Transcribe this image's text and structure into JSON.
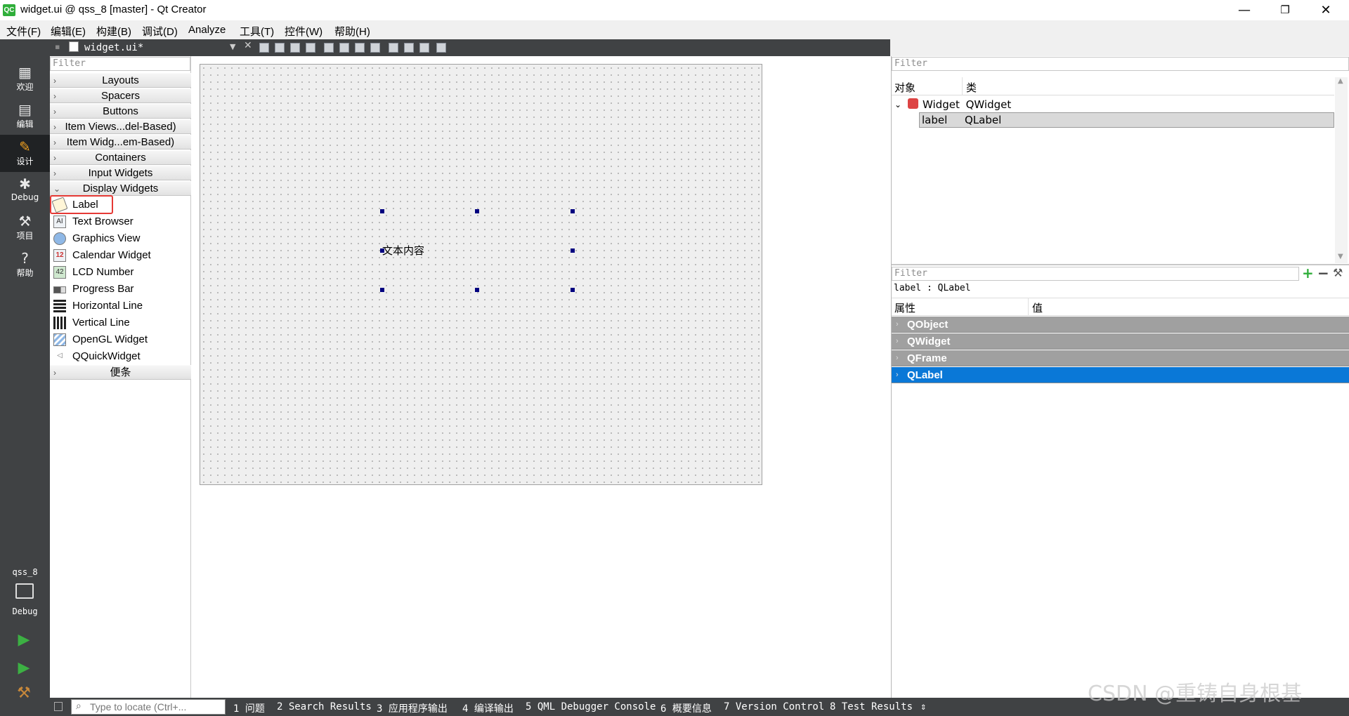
{
  "window": {
    "title": "widget.ui @ qss_8 [master] - Qt Creator",
    "app_icon_text": "QC",
    "minimize": "—",
    "restore": "❐",
    "close": "✕"
  },
  "menu": [
    "文件(F)",
    "编辑(E)",
    "构建(B)",
    "调试(D)",
    "Analyze",
    "工具(T)",
    "控件(W)",
    "帮助(H)"
  ],
  "modes": [
    {
      "label": "欢迎",
      "icon": "grid-icon"
    },
    {
      "label": "编辑",
      "icon": "document-icon"
    },
    {
      "label": "设计",
      "icon": "pencil-icon",
      "active": true
    },
    {
      "label": "Debug",
      "icon": "bug-icon"
    },
    {
      "label": "项目",
      "icon": "wrench-icon"
    },
    {
      "label": "帮助",
      "icon": "help-icon"
    }
  ],
  "kit": {
    "project": "qss_8",
    "build": "Debug"
  },
  "editor": {
    "doc_tab": "widget.ui*"
  },
  "widget_box": {
    "filter_placeholder": "Filter",
    "categories_top": [
      "Layouts",
      "Spacers",
      "Buttons",
      "Item Views...del-Based)",
      "Item Widg...em-Based)",
      "Containers",
      "Input Widgets",
      "Display Widgets"
    ],
    "items": [
      {
        "label": "Label",
        "icon": "label-tag-icon"
      },
      {
        "label": "Text Browser",
        "icon": "text-browser-icon"
      },
      {
        "label": "Graphics View",
        "icon": "graphics-view-icon"
      },
      {
        "label": "Calendar Widget",
        "icon": "calendar-icon"
      },
      {
        "label": "LCD Number",
        "icon": "lcd-icon"
      },
      {
        "label": "Progress Bar",
        "icon": "progress-bar-icon"
      },
      {
        "label": "Horizontal Line",
        "icon": "horizontal-line-icon"
      },
      {
        "label": "Vertical Line",
        "icon": "vertical-line-icon"
      },
      {
        "label": "OpenGL Widget",
        "icon": "opengl-icon"
      },
      {
        "label": "QQuickWidget",
        "icon": "qquick-icon"
      }
    ],
    "category_bottom": "便条"
  },
  "form": {
    "label_text": "文本内容"
  },
  "object_inspector": {
    "filter_placeholder": "Filter",
    "col_object": "对象",
    "col_class": "类",
    "rows": [
      {
        "object": "Widget",
        "class": "QWidget"
      },
      {
        "object": "label",
        "class": "QLabel"
      }
    ]
  },
  "property_editor": {
    "filter_placeholder": "Filter",
    "current": "label : QLabel",
    "col_property": "属性",
    "col_value": "值",
    "groups": [
      "QObject",
      "QWidget",
      "QFrame",
      "QLabel"
    ],
    "selected_group": "QLabel"
  },
  "statusbar": {
    "locator_placeholder": "Type to locate (Ctrl+...",
    "panes": [
      "1 问题",
      "2 Search Results",
      "3 应用程序输出",
      "4 编译输出",
      "5 QML Debugger Console",
      "6 概要信息",
      "7 Version Control",
      "8 Test Results"
    ]
  },
  "watermark": "CSDN @重铸自身根基",
  "colors": {
    "accent": "#0a78d7",
    "sidebar": "#404244",
    "highlight": "#e53935"
  }
}
